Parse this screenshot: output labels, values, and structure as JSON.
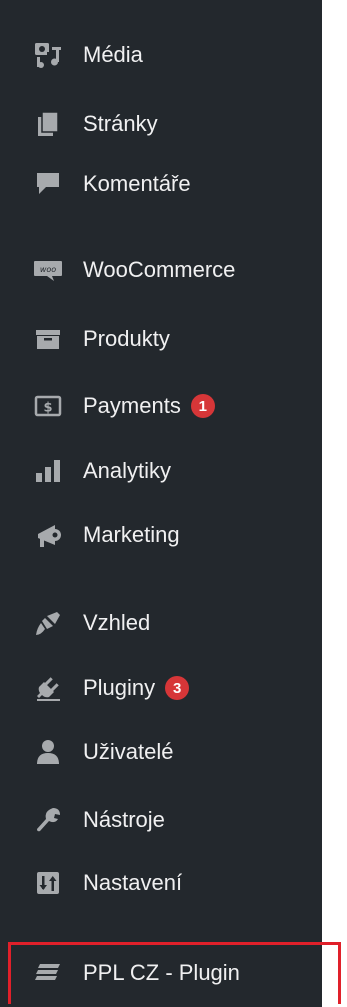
{
  "menu": {
    "items": [
      {
        "id": "media",
        "label": "Média",
        "icon": "media-icon"
      },
      {
        "id": "pages",
        "label": "Stránky",
        "icon": "pages-icon"
      },
      {
        "id": "comments",
        "label": "Komentáře",
        "icon": "comments-icon"
      },
      {
        "id": "woocommerce",
        "label": "WooCommerce",
        "icon": "woocommerce-icon",
        "icon_text": "woo"
      },
      {
        "id": "products",
        "label": "Produkty",
        "icon": "products-icon"
      },
      {
        "id": "payments",
        "label": "Payments",
        "icon": "payments-icon",
        "badge": "1"
      },
      {
        "id": "analytics",
        "label": "Analytiky",
        "icon": "analytics-icon"
      },
      {
        "id": "marketing",
        "label": "Marketing",
        "icon": "marketing-icon"
      },
      {
        "id": "appearance",
        "label": "Vzhled",
        "icon": "appearance-icon"
      },
      {
        "id": "plugins",
        "label": "Pluginy",
        "icon": "plugins-icon",
        "badge": "3"
      },
      {
        "id": "users",
        "label": "Uživatelé",
        "icon": "users-icon"
      },
      {
        "id": "tools",
        "label": "Nástroje",
        "icon": "tools-icon"
      },
      {
        "id": "settings",
        "label": "Nastavení",
        "icon": "settings-icon"
      },
      {
        "id": "ppl-cz-plugin",
        "label": "PPL CZ - Plugin",
        "icon": "ppl-plugin-icon"
      }
    ]
  },
  "colors": {
    "sidebar_bg": "#23282d",
    "text": "#f0f0f1",
    "icon": "#a7aaad",
    "badge_bg": "#d63638",
    "highlight_border": "#e0202a"
  }
}
